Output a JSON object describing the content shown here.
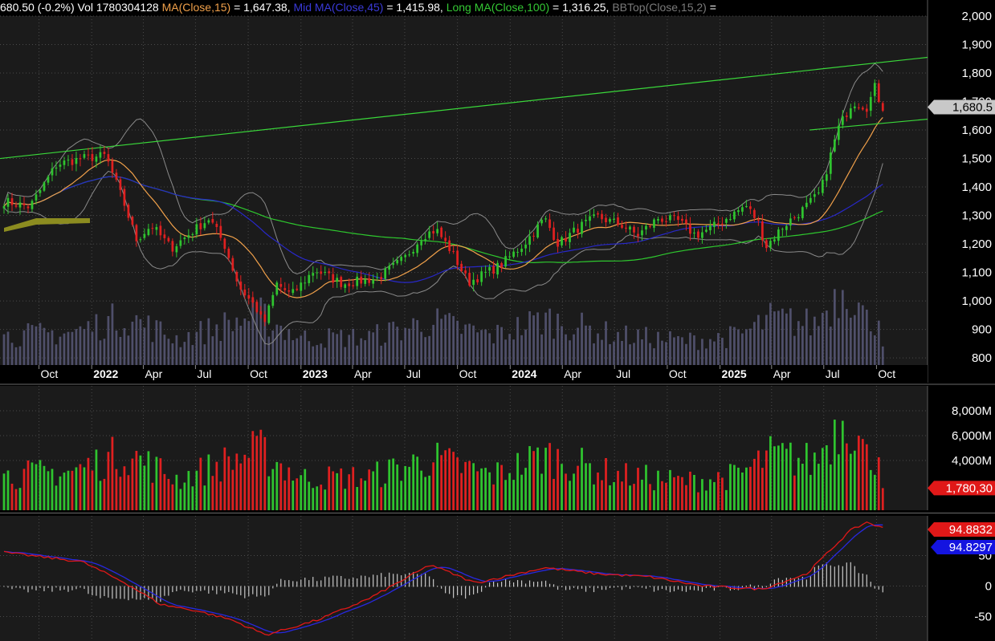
{
  "header": {
    "price_change": "680.50 (-0.2%)",
    "volume": "Vol 1780304128",
    "ma_short_label": "MA(Close,15)",
    "ma_short_value": "= 1,647.38,",
    "ma_mid_label": "Mid MA(Close,45)",
    "ma_mid_value": "= 1,415.98,",
    "ma_long_label": "Long MA(Close,100)",
    "ma_long_value": "= 1,316.25,",
    "bb_label": "BBTop(Close,15,2)",
    "bb_value": "="
  },
  "colors": {
    "background": "#000000",
    "pane_fill": "#1b1b1b",
    "up": "#2fc42f",
    "down": "#e02020",
    "ma_short": "#f0a04a",
    "ma_mid": "#2828c8",
    "ma_long": "#2ec82e",
    "bollinger": "#8a8a8a",
    "volume_overlay": "#585878",
    "trendline": "#3ad83a",
    "accumulation_band": "#8c8c20",
    "macd_line": "#e01818",
    "signal_line": "#2828e0",
    "histogram": "#c8c8c8",
    "grid": "#4a4a4a",
    "axis_text": "#ffffff"
  },
  "chart_data": [
    {
      "type": "candlestick",
      "pane": "price",
      "x_labels": [
        "Oct",
        "2022",
        "Apr",
        "Jul",
        "Oct",
        "2023",
        "Apr",
        "Jul",
        "Oct",
        "2024",
        "Apr",
        "Jul",
        "Oct",
        "2025",
        "Apr",
        "Jul",
        "Oct"
      ],
      "y_ticks": [
        "2,000",
        "1,900",
        "1,800",
        "1,700",
        "1,600",
        "1,500",
        "1,400",
        "1,300",
        "1,200",
        "1,100",
        "1,000",
        "900",
        "800"
      ],
      "ylim": [
        775,
        2000
      ],
      "last_price_label": "1,680.5",
      "anchors": [
        {
          "date": "2021-08-01",
          "close": 1350
        },
        {
          "date": "2021-09-15",
          "close": 1330
        },
        {
          "date": "2021-11-01",
          "close": 1480
        },
        {
          "date": "2021-12-15",
          "close": 1500
        },
        {
          "date": "2022-01-25",
          "close": 1510
        },
        {
          "date": "2022-02-25",
          "close": 1350
        },
        {
          "date": "2022-03-20",
          "close": 1215
        },
        {
          "date": "2022-04-15",
          "close": 1265
        },
        {
          "date": "2022-05-20",
          "close": 1185
        },
        {
          "date": "2022-06-20",
          "close": 1235
        },
        {
          "date": "2022-07-25",
          "close": 1290
        },
        {
          "date": "2022-08-20",
          "close": 1200
        },
        {
          "date": "2022-09-15",
          "close": 1050
        },
        {
          "date": "2022-10-15",
          "close": 975
        },
        {
          "date": "2022-10-28",
          "close": 915
        },
        {
          "date": "2022-11-20",
          "close": 1060
        },
        {
          "date": "2022-12-15",
          "close": 1020
        },
        {
          "date": "2023-01-25",
          "close": 1110
        },
        {
          "date": "2023-03-15",
          "close": 1060
        },
        {
          "date": "2023-05-15",
          "close": 1080
        },
        {
          "date": "2023-07-01",
          "close": 1150
        },
        {
          "date": "2023-08-01",
          "close": 1230
        },
        {
          "date": "2023-08-25",
          "close": 1250
        },
        {
          "date": "2023-09-20",
          "close": 1175
        },
        {
          "date": "2023-10-20",
          "close": 1065
        },
        {
          "date": "2023-12-15",
          "close": 1125
        },
        {
          "date": "2024-01-25",
          "close": 1200
        },
        {
          "date": "2024-03-01",
          "close": 1290
        },
        {
          "date": "2024-03-25",
          "close": 1200
        },
        {
          "date": "2024-05-01",
          "close": 1260
        },
        {
          "date": "2024-06-01",
          "close": 1295
        },
        {
          "date": "2024-07-15",
          "close": 1265
        },
        {
          "date": "2024-08-10",
          "close": 1230
        },
        {
          "date": "2024-09-15",
          "close": 1290
        },
        {
          "date": "2024-10-20",
          "close": 1280
        },
        {
          "date": "2024-11-20",
          "close": 1230
        },
        {
          "date": "2024-12-20",
          "close": 1260
        },
        {
          "date": "2025-01-20",
          "close": 1300
        },
        {
          "date": "2025-02-15",
          "close": 1335
        },
        {
          "date": "2025-03-08",
          "close": 1280
        },
        {
          "date": "2025-03-22",
          "close": 1190
        },
        {
          "date": "2025-04-20",
          "close": 1260
        },
        {
          "date": "2025-05-25",
          "close": 1320
        },
        {
          "date": "2025-06-25",
          "close": 1380
        },
        {
          "date": "2025-07-25",
          "close": 1600
        },
        {
          "date": "2025-08-20",
          "close": 1700
        },
        {
          "date": "2025-09-15",
          "close": 1680
        },
        {
          "date": "2025-09-28",
          "close": 1750
        },
        {
          "date": "2025-10-10",
          "close": 1680
        }
      ],
      "series": [
        "price candles",
        "MA(Close,15)",
        "Mid MA(Close,45)",
        "Long MA(Close,100)",
        "BBTop(Close,15,2)"
      ]
    },
    {
      "type": "bar",
      "pane": "volume",
      "y_ticks": [
        "8,000M",
        "6,000M",
        "4,000M"
      ],
      "ylim": [
        0,
        10000
      ],
      "unit": "M",
      "last_volume_label": "1,780,30",
      "anchors": [
        {
          "date": "2021-08-01",
          "value": 3000
        },
        {
          "date": "2021-12-01",
          "value": 3400
        },
        {
          "date": "2022-03-01",
          "value": 5000
        },
        {
          "date": "2022-06-01",
          "value": 2700
        },
        {
          "date": "2022-10-20",
          "value": 5200
        },
        {
          "date": "2023-01-01",
          "value": 2800
        },
        {
          "date": "2023-05-01",
          "value": 2900
        },
        {
          "date": "2023-08-15",
          "value": 4500
        },
        {
          "date": "2023-12-01",
          "value": 3000
        },
        {
          "date": "2024-03-01",
          "value": 4800
        },
        {
          "date": "2024-07-01",
          "value": 3100
        },
        {
          "date": "2024-11-01",
          "value": 2500
        },
        {
          "date": "2025-02-01",
          "value": 3000
        },
        {
          "date": "2025-04-01",
          "value": 4800
        },
        {
          "date": "2025-06-15",
          "value": 4200
        },
        {
          "date": "2025-08-10",
          "value": 8600
        },
        {
          "date": "2025-09-15",
          "value": 4400
        },
        {
          "date": "2025-10-10",
          "value": 5200
        }
      ]
    },
    {
      "type": "line",
      "pane": "oscillator",
      "y_ticks": [
        "50",
        "0",
        "-50"
      ],
      "ylim": [
        -90,
        115
      ],
      "macd_value_label": "94.8832",
      "signal_value_label": "94.8297",
      "anchors": [
        {
          "date": "2021-08-01",
          "value": 55
        },
        {
          "date": "2021-12-15",
          "value": 40
        },
        {
          "date": "2022-03-01",
          "value": 5
        },
        {
          "date": "2022-05-01",
          "value": -30
        },
        {
          "date": "2022-07-01",
          "value": -40
        },
        {
          "date": "2022-09-01",
          "value": -55
        },
        {
          "date": "2022-11-01",
          "value": -80
        },
        {
          "date": "2023-02-01",
          "value": -55
        },
        {
          "date": "2023-05-01",
          "value": -20
        },
        {
          "date": "2023-08-15",
          "value": 35
        },
        {
          "date": "2023-11-01",
          "value": 5
        },
        {
          "date": "2024-03-01",
          "value": 30
        },
        {
          "date": "2024-06-01",
          "value": 20
        },
        {
          "date": "2024-09-01",
          "value": 15
        },
        {
          "date": "2024-12-01",
          "value": 0
        },
        {
          "date": "2025-03-15",
          "value": -5
        },
        {
          "date": "2025-06-01",
          "value": 20
        },
        {
          "date": "2025-08-15",
          "value": 90
        },
        {
          "date": "2025-09-15",
          "value": 105
        },
        {
          "date": "2025-10-10",
          "value": 95
        }
      ],
      "series": [
        "MACD",
        "Signal",
        "Histogram"
      ]
    }
  ]
}
